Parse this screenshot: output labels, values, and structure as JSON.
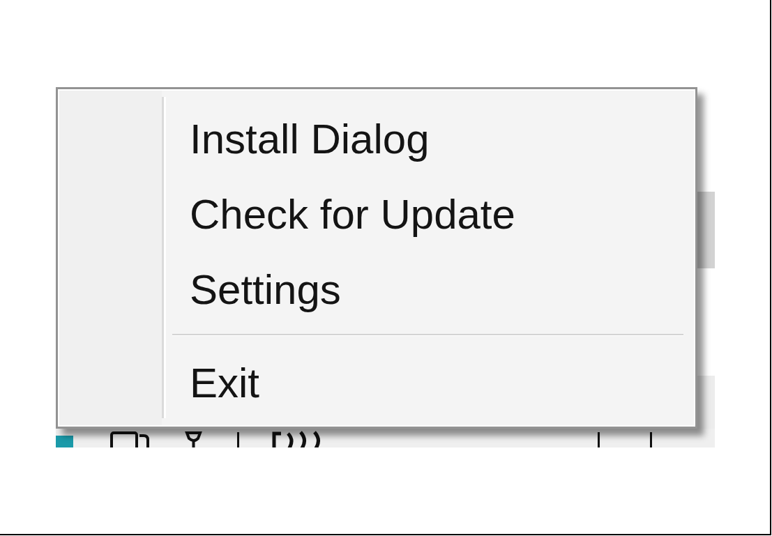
{
  "context_menu": {
    "items": [
      {
        "kind": "item",
        "label": "Install Dialog"
      },
      {
        "kind": "item",
        "label": "Check for Update"
      },
      {
        "kind": "item",
        "label": "Settings"
      },
      {
        "kind": "separator"
      },
      {
        "kind": "item",
        "label": "Exit"
      }
    ]
  }
}
